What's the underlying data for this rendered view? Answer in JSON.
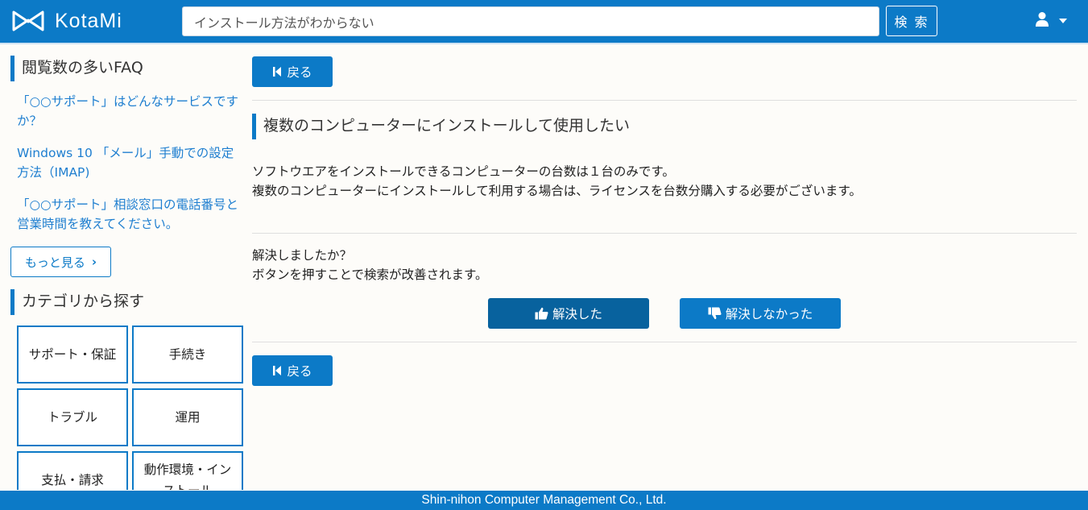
{
  "header": {
    "logo_text": "KotaMi",
    "search_value": "インストール方法がわからない",
    "search_button": "検 索"
  },
  "sidebar": {
    "faq_title": "閲覧数の多いFAQ",
    "faq_links": [
      "「○○サポート」はどんなサービスですか？",
      "Windows 10 「メール」手動での設定方法（IMAP)",
      "「○○サポート」相談窓口の電話番号と営業時間を教えてください。"
    ],
    "more_label": "もっと見る",
    "category_title": "カテゴリから探す",
    "categories": [
      "サポート・保証",
      "手続き",
      "トラブル",
      "運用",
      "支払・請求",
      "動作環境・インストール"
    ]
  },
  "main": {
    "back_label": "戻る",
    "question_title": "複数のコンピューターにインストールして使用したい",
    "answer_lines": [
      "ソフトウエアをインストールできるコンピューターの台数は１台のみです。",
      "複数のコンピューターにインストールして利用する場合は、ライセンスを台数分購入する必要がございます。"
    ],
    "feedback_lines": [
      "解決しましたか？",
      "ボタンを押すことで検索が改善されます。"
    ],
    "resolved_label": "解決した",
    "not_resolved_label": "解決しなかった"
  },
  "footer": {
    "text": "Shin-nihon Computer Management Co., Ltd."
  },
  "colors": {
    "brand": "#0c7ac7",
    "link": "#1f7fd0",
    "resolved_button": "#08629e"
  }
}
